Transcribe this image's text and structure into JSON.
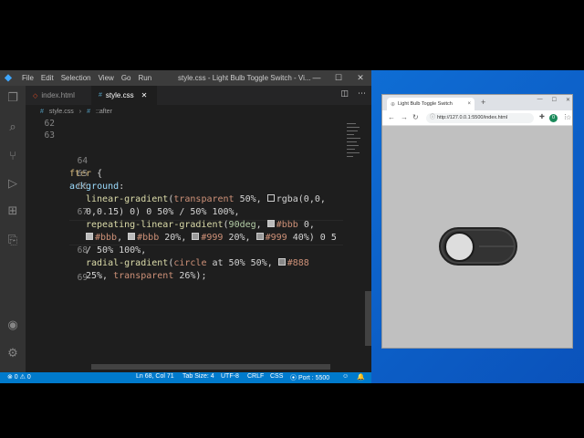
{
  "vscode": {
    "logo": "◆",
    "menu": [
      "File",
      "Edit",
      "Selection",
      "View",
      "Go",
      "Run"
    ],
    "window_title": "style.css - Light Bulb Toggle Switch - Vi...",
    "window_controls": [
      "—",
      "☐",
      "✕"
    ],
    "tabs": [
      {
        "label": "index.html",
        "icon": "◇"
      },
      {
        "label": "style.css",
        "icon": "#",
        "close": "✕"
      }
    ],
    "breadcrumb": {
      "file": "style.css",
      "selector": "::after"
    },
    "lines": [
      {
        "num": "62"
      },
      {
        "num": "63"
      },
      {
        "num": "64"
      },
      {
        "num": "65"
      },
      {
        "num": "66"
      },
      {
        "num": ""
      },
      {
        "num": "67"
      },
      {
        "num": ""
      },
      {
        "num": ""
      },
      {
        "num": "68"
      },
      {
        "num": ""
      },
      {
        "num": "69"
      }
    ],
    "code": {
      "l64_sel": "fter",
      "l64_brace": " {",
      "l65_prop": "ackground",
      "l65_colon": ":",
      "l66_fn": "linear-gradient",
      "l66_a": "(",
      "l66_b": "transparent",
      "l66_c": " 50%, ",
      "l66_d": "rgba(0,0,",
      "l66b_a": "0,0.15) 0) 0 50% / 50% 100%,",
      "l67_fn": "repeating-linear-gradient",
      "l67_a": "(",
      "l67_b": "90deg",
      "l67_c": ", ",
      "l67_d": "#bbb",
      "l67_e": " 0,",
      "l67b_1": "#bbb",
      "l67b_2": ", ",
      "l67b_3": "#bbb",
      "l67b_4": " 20%, ",
      "l67b_5": "#999",
      "l67b_6": " 20%, ",
      "l67b_7": "#999",
      "l67b_8": " 40%) 0 5",
      "l67c": "/ 50% 100%,",
      "l68_fn": "radial-gradient",
      "l68_a": "(",
      "l68_b": "circle",
      "l68_c": " at 50% 50%, ",
      "l68_d": "#888",
      "l68b_a": "25%, ",
      "l68b_b": "transparent",
      "l68b_c": " 26%);"
    },
    "status": {
      "problems": "⊗ 0 ⚠ 0",
      "position": "Ln 68, Col 71",
      "tab_size": "Tab Size: 4",
      "encoding": "UTF-8",
      "eol": "CRLF",
      "language": "CSS",
      "port": "⦿ Port : 5500",
      "feedback": "☺",
      "bell": "🔔"
    }
  },
  "browser": {
    "tab_title": "Light Bulb Toggle Switch",
    "tab_close": "×",
    "new_tab": "+",
    "window_controls": [
      "—",
      "☐",
      "✕"
    ],
    "url": "http://127.0.0.1:5500/index.html",
    "avatar_letter": "0",
    "nav": [
      "←",
      "→",
      "↻"
    ],
    "toggle_state": "off"
  }
}
